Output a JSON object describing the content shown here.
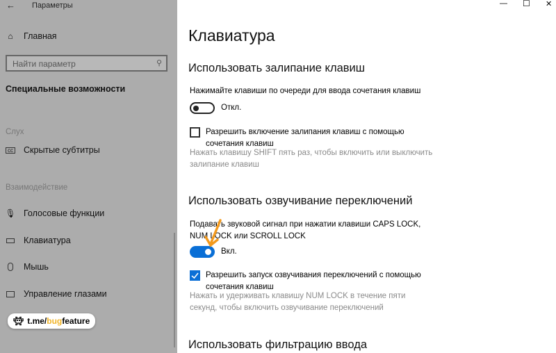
{
  "window": {
    "title": "Параметры",
    "back": "←",
    "min": "—",
    "max": "☐",
    "close": "✕"
  },
  "sidebar": {
    "home": "Главная",
    "search_placeholder": "Найти параметр",
    "section": "Специальные возможности",
    "group_hearing": "Слух",
    "captions": "Скрытые субтитры",
    "group_interaction": "Взаимодействие",
    "items": [
      {
        "label": "Голосовые функции"
      },
      {
        "label": "Клавиатура"
      },
      {
        "label": "Мышь"
      },
      {
        "label": "Управление глазами"
      }
    ],
    "watermark": {
      "prefix": "t.me/",
      "highlight": "bug",
      "suffix": "feature",
      "accent": "#f0b429"
    }
  },
  "main": {
    "title": "Клавиатура",
    "sticky": {
      "heading": "Использовать залипание клавиш",
      "desc": "Нажимайте клавиши по очереди для ввода сочетания клавиш",
      "toggle_state": "Откл.",
      "toggle_on": false,
      "checkbox_label": "Разрешить включение залипания клавиш с помощью сочетания клавиш",
      "checked": false,
      "hint": "Нажать клавишу SHIFT пять раз, чтобы включить или выключить залипание клавиш"
    },
    "toggle_keys": {
      "heading": "Использовать озвучивание переключений",
      "desc": "Подавать звуковой сигнал при нажатии клавиши CAPS LOCK, NUM LOCK или SCROLL LOCK",
      "toggle_state": "Вкл.",
      "toggle_on": true,
      "checkbox_label": "Разрешить запуск озвучивания переключений с помощью сочетания клавиш",
      "checked": true,
      "hint": "Нажать и удерживать клавишу NUM LOCK в течение пяти секунд, чтобы включить озвучивание переключений"
    },
    "filter": {
      "heading": "Использовать фильтрацию ввода"
    },
    "accent": "#0a6fd6"
  }
}
